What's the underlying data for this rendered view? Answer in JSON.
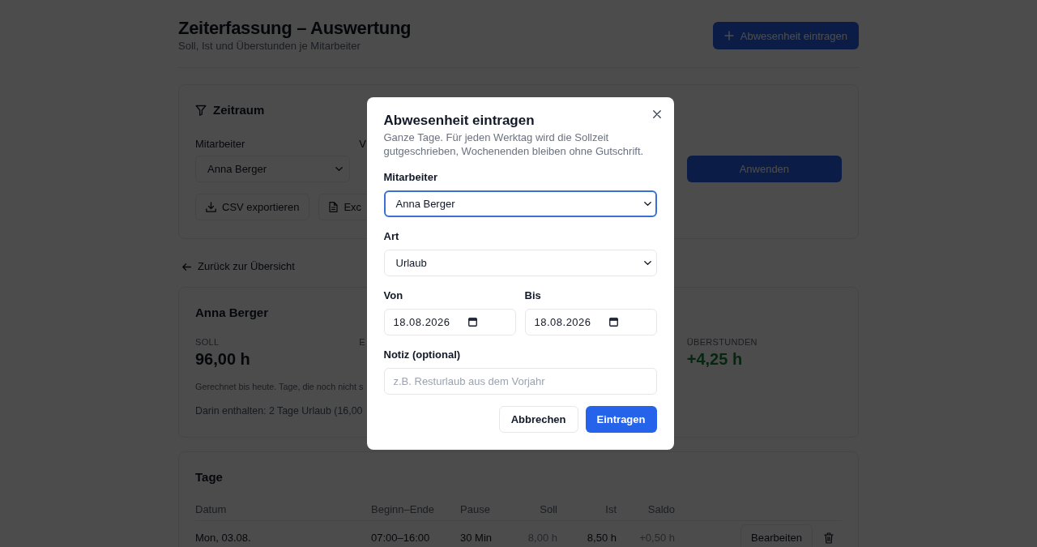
{
  "header": {
    "title": "Zeiterfassung – Auswertung",
    "subtitle": "Soll, Ist und Überstunden je Mitarbeiter",
    "action": "Abwesenheit eintragen"
  },
  "filter": {
    "title": "Zeitraum",
    "fields": [
      {
        "label": "Mitarbeiter",
        "value": "Anna Berger"
      },
      {
        "label": "V"
      }
    ],
    "apply": "Anwenden",
    "exports": [
      "CSV exportieren",
      "Exc"
    ]
  },
  "back_link": "Zurück zur Übersicht",
  "summary": {
    "name": "Anna Berger",
    "stats": [
      {
        "label": "SOLL",
        "value": "96,00 h",
        "positive": false
      },
      {
        "label": "E"
      },
      {
        "label": "ÜBERSTUNDEN",
        "value": "+4,25 h",
        "positive": true
      }
    ],
    "note": "Gerechnet bis heute. Tage, die noch nicht s",
    "detail": "Darin enthalten: 2 Tage Urlaub (16,00"
  },
  "days": {
    "title": "Tage",
    "columns": [
      "Datum",
      "Beginn–Ende",
      "Pause",
      "Soll",
      "Ist",
      "Saldo"
    ],
    "rows": [
      {
        "cells": [
          {
            "text": "Mon, 03.08.",
            "muted": false
          },
          {
            "text": "07:00–16:00",
            "muted": false
          },
          {
            "text": "30 Min",
            "muted": false
          },
          {
            "text": "8,00 h",
            "muted": true
          },
          {
            "text": "8,50 h",
            "muted": false
          },
          {
            "text": "+0,50 h",
            "muted": true
          }
        ],
        "action": "Bearbeiten"
      }
    ]
  },
  "dialog": {
    "title": "Abwesenheit eintragen",
    "description": "Ganze Tage. Für jeden Werktag wird die Sollzeit gutgeschrieben, Wochenenden bleiben ohne Gutschrift.",
    "rows": [
      {
        "fields": [
          {
            "kind": "select",
            "label": "Mitarbeiter",
            "value": "Anna Berger",
            "focused": true
          }
        ]
      },
      {
        "fields": [
          {
            "kind": "select",
            "label": "Art",
            "value": "Urlaub",
            "focused": false
          }
        ]
      },
      {
        "fields": [
          {
            "kind": "date",
            "label": "Von",
            "value": "18.08.2026",
            "focused": false
          },
          {
            "kind": "date",
            "label": "Bis",
            "value": "18.08.2026",
            "focused": false
          }
        ]
      },
      {
        "fields": [
          {
            "kind": "text",
            "label": "Notiz (optional)",
            "placeholder": "z.B. Resturlaub aus dem Vorjahr",
            "focused": false
          }
        ]
      }
    ],
    "buttons": [
      {
        "kind": "secondary",
        "label": "Abbrechen"
      },
      {
        "kind": "primary",
        "label": "Eintragen"
      }
    ]
  }
}
